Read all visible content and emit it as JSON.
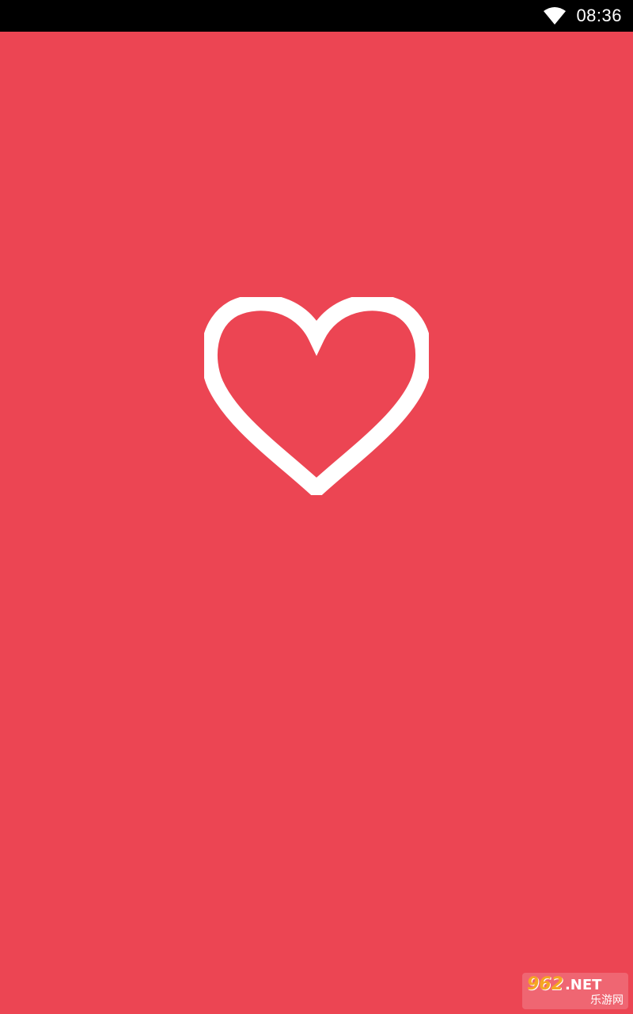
{
  "status_bar": {
    "time": "08:36",
    "wifi_icon": "wifi-icon"
  },
  "splash": {
    "background_color": "#EC4553",
    "icon": "heart-outline-icon",
    "icon_color": "#FFFFFF"
  },
  "watermark": {
    "number": "962",
    "suffix": ".NET",
    "subtitle": "乐游网"
  }
}
